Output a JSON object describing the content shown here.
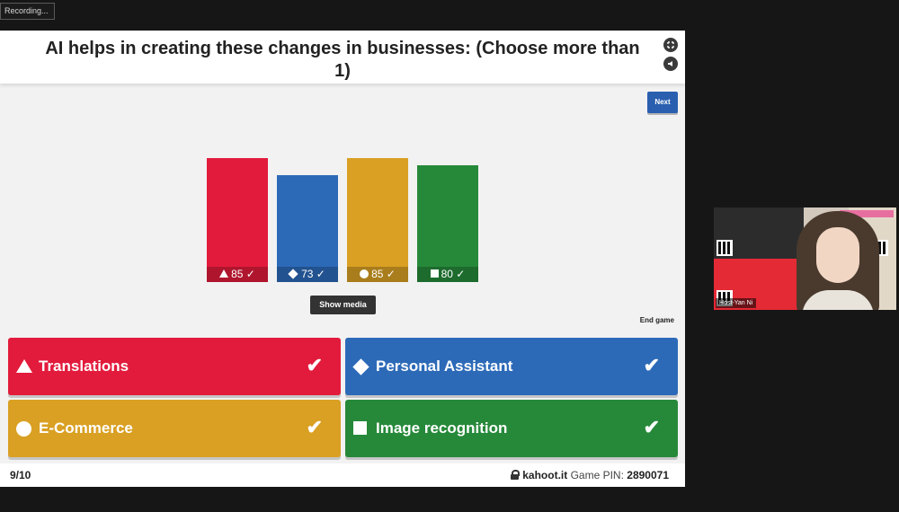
{
  "recording": {
    "label": "Recording..."
  },
  "question": {
    "text": "AI helps in creating these changes in businesses: (Choose more than 1)"
  },
  "controls": {
    "next_label": "Next",
    "show_media_label": "Show media",
    "end_game_label": "End game"
  },
  "chart_data": {
    "type": "bar",
    "categories": [
      "Translations",
      "Personal Assistant",
      "E-Commerce",
      "Image recognition"
    ],
    "values": [
      85,
      73,
      85,
      80
    ],
    "colors": [
      "#e21b3c",
      "#2c6ab8",
      "#d9a023",
      "#26893a"
    ],
    "symbols": [
      "triangle",
      "diamond",
      "circle",
      "square"
    ],
    "correct": [
      true,
      true,
      true,
      true
    ],
    "check_glyph": "✓"
  },
  "answers": [
    {
      "label": "Translations",
      "shape": "triangle",
      "color": "#e21b3c",
      "correct": true
    },
    {
      "label": "Personal Assistant",
      "shape": "diamond",
      "color": "#2c6ab8",
      "correct": true
    },
    {
      "label": "E-Commerce",
      "shape": "circle",
      "color": "#d9a023",
      "correct": true
    },
    {
      "label": "Image recognition",
      "shape": "square",
      "color": "#26893a",
      "correct": true
    }
  ],
  "footer": {
    "progress": "9/10",
    "site": "kahoot.it",
    "pin_label": "Game PIN:",
    "pin": "2890071"
  },
  "webcam": {
    "name_label": "Host-Yan Ni"
  }
}
